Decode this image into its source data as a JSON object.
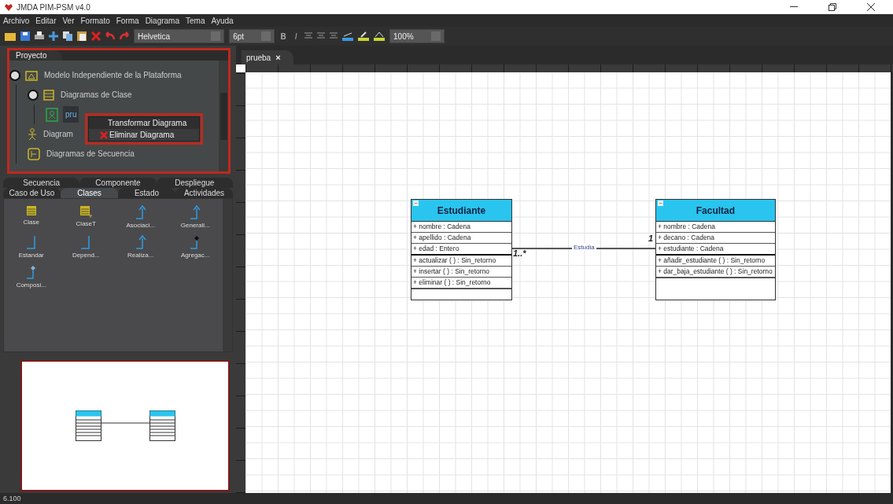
{
  "window": {
    "title": "JMDA PIM-PSM v4.0"
  },
  "menu": [
    "Archivo",
    "Editar",
    "Ver",
    "Formato",
    "Forma",
    "Diagrama",
    "Tema",
    "Ayuda"
  ],
  "toolbar": {
    "font": "Helvetica",
    "size": "6pt",
    "bold": "B",
    "italic": "I",
    "zoom": "100%"
  },
  "project_panel": {
    "tab": "Proyecto",
    "tree": [
      {
        "label": "Modelo Independiente de la Plataforma",
        "kind": "model",
        "expanded": true,
        "selected": false,
        "children": [
          {
            "label": "Diagramas de Clase",
            "kind": "class-diagrams",
            "expanded": true,
            "selected": false,
            "children": [
              {
                "label": "pru",
                "kind": "diagram",
                "selected": true
              }
            ]
          },
          {
            "label": "Diagram",
            "kind": "use-case",
            "selected": false
          },
          {
            "label": "Diagramas de Secuencia",
            "kind": "sequence",
            "selected": false
          }
        ]
      }
    ],
    "context_menu": [
      {
        "label": "Transformar Diagrama",
        "kind": "plain"
      },
      {
        "label": "Eliminar Diagrama",
        "kind": "delete"
      }
    ]
  },
  "palette": {
    "tab_rows": [
      [
        {
          "label": "Secuencia",
          "selected": false
        },
        {
          "label": "Componente",
          "selected": false
        },
        {
          "label": "Despliegue",
          "selected": false
        }
      ],
      [
        {
          "label": "Caso de Uso",
          "selected": false
        },
        {
          "label": "Clases",
          "selected": true
        },
        {
          "label": "Estado",
          "selected": false
        },
        {
          "label": "Actividades",
          "selected": false
        }
      ]
    ],
    "items": [
      {
        "label": "Clase",
        "kind": "class"
      },
      {
        "label": "ClaseT",
        "kind": "class-template"
      },
      {
        "label": "Asociaci...",
        "kind": "association"
      },
      {
        "label": "Generali...",
        "kind": "generalization"
      },
      {
        "label": "Estandar",
        "kind": "link"
      },
      {
        "label": "Depend...",
        "kind": "link"
      },
      {
        "label": "Realiza...",
        "kind": "association"
      },
      {
        "label": "Agregac...",
        "kind": "aggregation"
      },
      {
        "label": "Composi...",
        "kind": "composition"
      }
    ]
  },
  "editor": {
    "tab": "prueba",
    "close": "×",
    "classes": [
      {
        "name": "Estudiante",
        "collapse": "−",
        "attributes": [
          "+ nombre : Cadena",
          "+ apellido : Cadena",
          "+ edad : Entero"
        ],
        "methods": [
          "+ actualizar ( ) : Sin_retorno",
          "+ insertar ( ) : Sin_retorno",
          "+ eliminar ( ) : Sin_retorno"
        ]
      },
      {
        "name": "Facultad",
        "collapse": "−",
        "attributes": [
          "+ nombre : Cadena",
          "+ decano : Cadena",
          "+ estudiante : Cadena"
        ],
        "methods": [
          "+ añadir_estudiante ( ) : Sin_retorno",
          "+ dar_baja_estudiante ( ) : Sin_retorno"
        ]
      }
    ],
    "association": {
      "label": "Estudia",
      "source_multiplicity": "1..*",
      "target_multiplicity": "1"
    }
  },
  "status_bar": "6.100"
}
